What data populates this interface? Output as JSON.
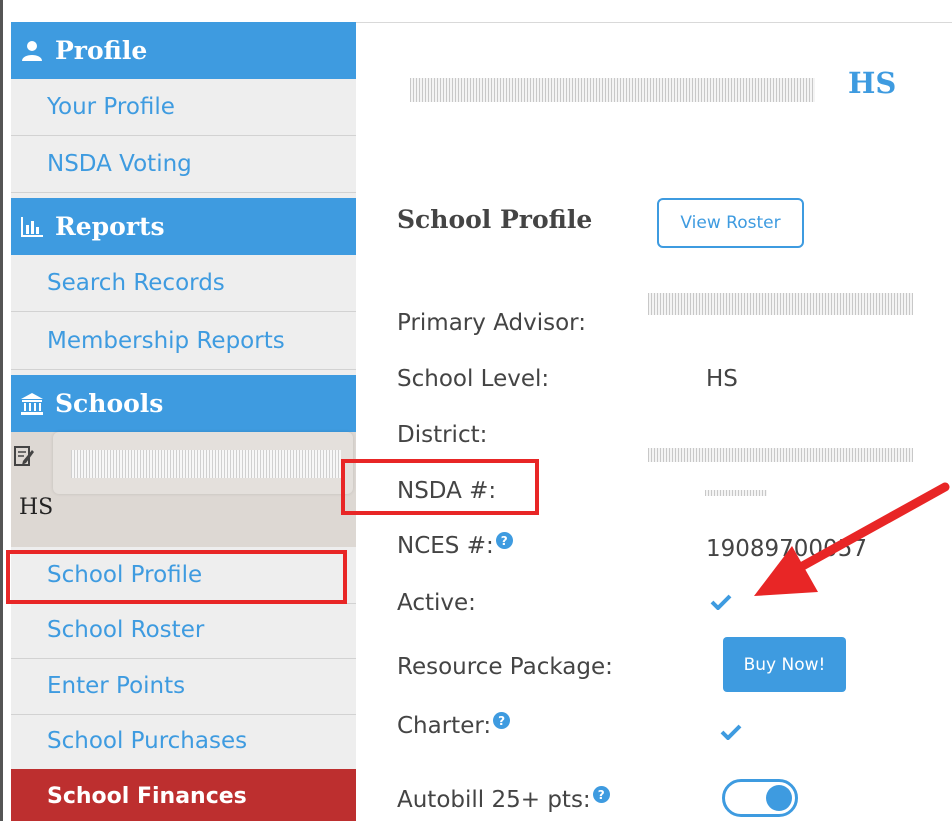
{
  "sidebar": {
    "profile_header": "Profile",
    "profile_items": [
      "Your Profile",
      "NSDA Voting"
    ],
    "reports_header": "Reports",
    "reports_items": [
      "Search Records",
      "Membership Reports"
    ],
    "schools_header": "Schools",
    "school_level": "HS",
    "school_items": [
      "School Profile",
      "School Roster",
      "Enter Points",
      "School Purchases"
    ],
    "active_item": "School Finances"
  },
  "main": {
    "header_level": "HS",
    "section_title": "School Profile",
    "view_roster_label": "View Roster",
    "fields": {
      "primary_advisor": {
        "label": "Primary Advisor:",
        "value": ""
      },
      "school_level": {
        "label": "School Level:",
        "value": "HS"
      },
      "district": {
        "label": "District:",
        "value": ""
      },
      "nsda_number": {
        "label": "NSDA #:",
        "value": ""
      },
      "nces_number": {
        "label": "NCES #:",
        "value": "19089700057"
      },
      "active": {
        "label": "Active:",
        "checked": true
      },
      "resource_package": {
        "label": "Resource Package:",
        "button": "Buy Now!"
      },
      "charter": {
        "label": "Charter:",
        "checked": true
      },
      "autobill": {
        "label": "Autobill 25+ pts:",
        "enabled": true
      }
    },
    "help_glyph": "?"
  },
  "colors": {
    "accent": "#3e9be0",
    "finances_bg": "#bd2f2f",
    "annotation": "#e82626"
  },
  "icons": [
    "user-icon",
    "bar-chart-icon",
    "bank-icon",
    "edit-icon",
    "check-icon",
    "help-icon"
  ]
}
